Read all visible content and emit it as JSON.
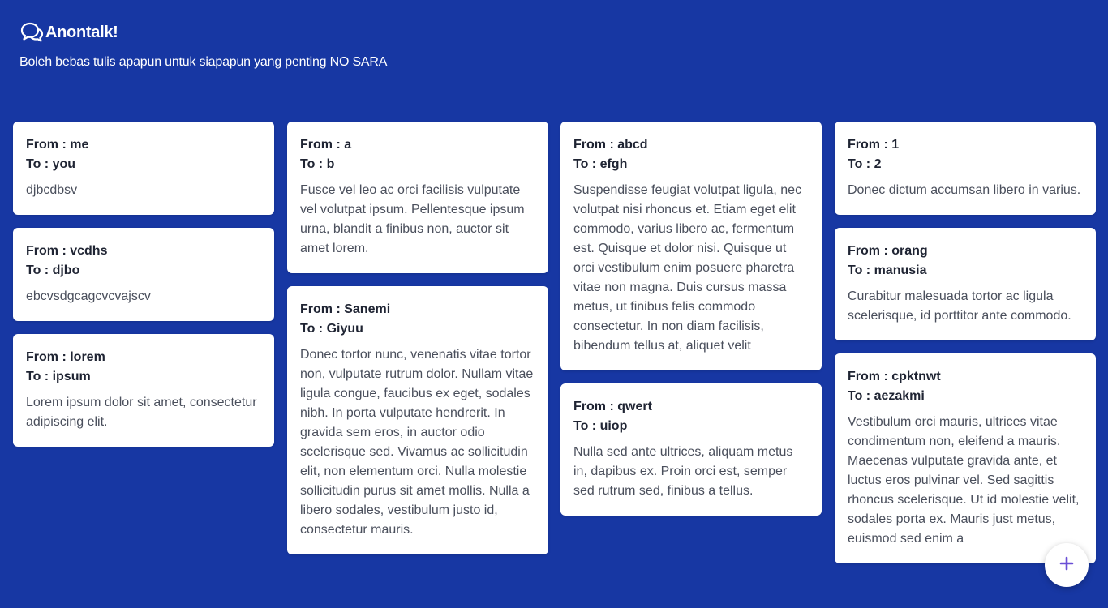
{
  "app": {
    "title": "Anontalk!",
    "tagline": "Boleh bebas tulis apapun untuk siapapun yang penting NO SARA"
  },
  "colors": {
    "background": "#1737a3",
    "card": "#ffffff",
    "accent": "#6a4fd6"
  },
  "icons": {
    "logo": "chat-bubbles-icon",
    "fab": "plus-icon"
  },
  "columns": [
    {
      "cards": [
        {
          "from": "From : me",
          "to": "To : you",
          "message": "djbcdbsv"
        },
        {
          "from": "From : vcdhs",
          "to": "To : djbo",
          "message": "ebcvsdgcagcvcvajscv"
        },
        {
          "from": "From : lorem",
          "to": "To : ipsum",
          "message": "Lorem ipsum dolor sit amet, consectetur adipiscing elit."
        }
      ]
    },
    {
      "cards": [
        {
          "from": "From : a",
          "to": "To : b",
          "message": "Fusce vel leo ac orci facilisis vulputate vel volutpat ipsum. Pellentesque ipsum urna, blandit a finibus non, auctor sit amet lorem."
        },
        {
          "from": "From : Sanemi",
          "to": "To : Giyuu",
          "message": "Donec tortor nunc, venenatis vitae tortor non, vulputate rutrum dolor. Nullam vitae ligula congue, faucibus ex eget, sodales nibh. In porta vulputate hendrerit. In gravida sem eros, in auctor odio scelerisque sed. Vivamus ac sollicitudin elit, non elementum orci. Nulla molestie sollicitudin purus sit amet mollis. Nulla a libero sodales, vestibulum justo id, consectetur mauris."
        }
      ]
    },
    {
      "cards": [
        {
          "from": "From : abcd",
          "to": "To : efgh",
          "message": "Suspendisse feugiat volutpat ligula, nec volutpat nisi rhoncus et. Etiam eget elit commodo, varius libero ac, fermentum est. Quisque et dolor nisi. Quisque ut orci vestibulum enim posuere pharetra vitae non magna. Duis cursus massa metus, ut finibus felis commodo consectetur. In non diam facilisis, bibendum tellus at, aliquet velit"
        },
        {
          "from": "From : qwert",
          "to": "To : uiop",
          "message": "Nulla sed ante ultrices, aliquam metus in, dapibus ex. Proin orci est, semper sed rutrum sed, finibus a tellus."
        }
      ]
    },
    {
      "cards": [
        {
          "from": "From : 1",
          "to": "To : 2",
          "message": "Donec dictum accumsan libero in varius."
        },
        {
          "from": "From : orang",
          "to": "To : manusia",
          "message": "Curabitur malesuada tortor ac ligula scelerisque, id porttitor ante commodo."
        },
        {
          "from": "From : cpktnwt",
          "to": "To : aezakmi",
          "message": "Vestibulum orci mauris, ultrices vitae condimentum non, eleifend a mauris. Maecenas vulputate gravida ante, et luctus eros pulvinar vel. Sed sagittis rhoncus scelerisque. Ut id molestie velit, sodales porta ex. Mauris just metus, euismod sed enim a"
        }
      ]
    }
  ]
}
